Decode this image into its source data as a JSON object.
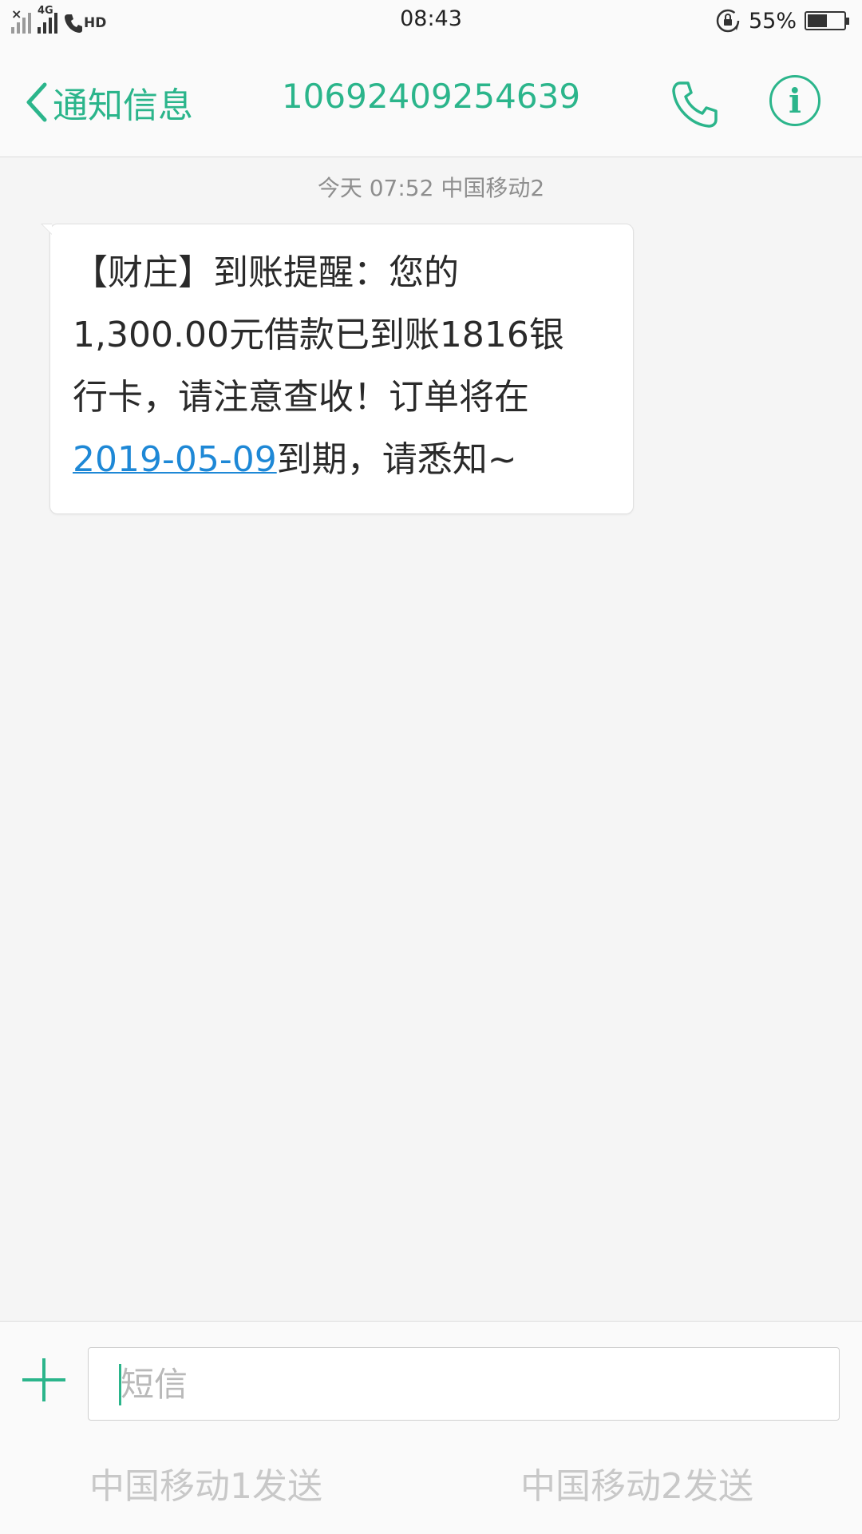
{
  "status_bar": {
    "time": "08:43",
    "network": "4G",
    "hd": "HD",
    "battery_percent": "55%",
    "battery_level": 0.55
  },
  "header": {
    "back_label": "通知信息",
    "title": "10692409254639",
    "call_icon": "phone-icon",
    "info_icon": "info-icon",
    "info_glyph": "i",
    "accent_color": "#2bb58b"
  },
  "conversation": {
    "timestamp": "今天 07:52  中国移动2",
    "message": {
      "line1": "【财庄】到账提醒：您的",
      "line2": "1,300.00元借款已到账1816银",
      "line3": "行卡，请注意查收！订单将在",
      "link_date": "2019-05-09",
      "line4_rest": "到期，请悉知~"
    }
  },
  "composer": {
    "placeholder": "短信",
    "send_sim1": "中国移动1发送",
    "send_sim2": "中国移动2发送"
  }
}
